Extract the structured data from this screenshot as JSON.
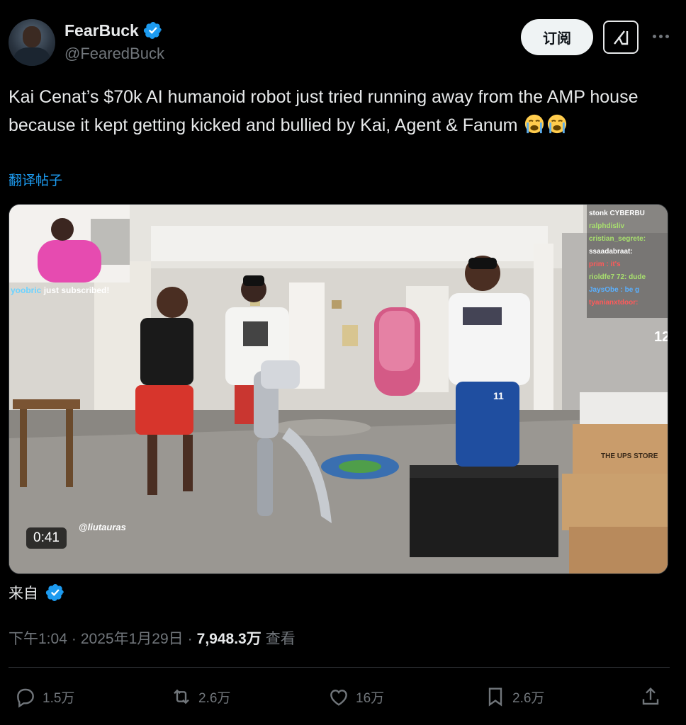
{
  "author": {
    "name": "FearBuck",
    "handle": "@FearedBuck"
  },
  "header": {
    "subscribe_label": "订阅"
  },
  "tweet": {
    "text": "Kai Cenat’s $70k AI humanoid robot just tried running away from the AMP house because it kept getting kicked and bullied by Kai, Agent & Fanum",
    "emojis": [
      "loudly-crying-face",
      "loudly-crying-face"
    ],
    "translate_label": "翻译帖子"
  },
  "media": {
    "overlay_subscriber": "yoobric",
    "overlay_subscribed_text": "just subscribed!",
    "overlay_watermark": "@liutauras",
    "chat_lines": [
      "stonk CYBERBU",
      "ralphdisliv",
      "cristian_segrete:",
      "ssaadabraat:",
      "prim : it's",
      "rioldfe7 72: dude",
      "JaysObe : be g",
      "tyanianxtdoor:"
    ],
    "chat_counter": "12",
    "box_label": "THE UPS STORE",
    "jersey_number": "11",
    "duration": "0:41"
  },
  "source": {
    "label": "来自"
  },
  "meta": {
    "time": "下午1:04",
    "separator": "·",
    "date": "2025年1月29日",
    "views_count": "7,948.3万",
    "views_label": "查看"
  },
  "actions": {
    "reply_count": "1.5万",
    "retweet_count": "2.6万",
    "like_count": "16万",
    "bookmark_count": "2.6万"
  },
  "colors": {
    "accent": "#1d9bf0",
    "background": "#000000",
    "text": "#e7e9ea",
    "muted": "#71767b"
  }
}
